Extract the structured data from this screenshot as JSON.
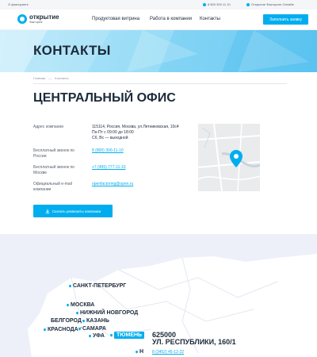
{
  "topbar": {
    "about": "О факторинге",
    "phone": "8 800 300 11 10",
    "online": "Открытие Факторинг Онлайн"
  },
  "header": {
    "logo_name": "открытие",
    "logo_sub": "Факторинг",
    "nav": [
      "Продуктовая витрина",
      "Работа в компании",
      "Контакты"
    ],
    "cta": "Заполнить заявку"
  },
  "hero": {
    "title": "КОНТАКТЫ"
  },
  "breadcrumb": {
    "home": "Главная",
    "separator": "—",
    "current": "Контакты"
  },
  "office": {
    "title": "ЦЕНТРАЛЬНЫЙ ОФИС",
    "rows": [
      {
        "label": "Адрес компании",
        "value_lines": [
          "115114, Россия, Москва, ул.Летниковская, 10с4",
          "Пн-Пт с 09:00 до 18:00",
          "Сб, Вс — выходной"
        ],
        "link": false
      },
      {
        "label": "Бесплатный звонок по России",
        "value_lines": [
          "8 (800) 300-11-10"
        ],
        "link": true
      },
      {
        "label": "Бесплатный звонок по Москве",
        "value_lines": [
          "+7 (495) 777-11-10"
        ],
        "link": true
      },
      {
        "label": "Официальный e-mail компании",
        "value_lines": [
          "openfactoring@open.ru"
        ],
        "link": true
      }
    ],
    "download_label": "Скачать реквизиты компании"
  },
  "regions": {
    "cities": [
      {
        "name": "САНКТ-ПЕТЕРБУРГ",
        "active": false
      },
      {
        "name": "МОСКВА",
        "active": false
      },
      {
        "name": "НИЖНИЙ НОВГОРОД",
        "active": false
      },
      {
        "name": "БЕЛГОРОД",
        "active": false
      },
      {
        "name": "КАЗАНЬ",
        "active": false
      },
      {
        "name": "КРАСНОДАР",
        "active": false
      },
      {
        "name": "САМАРА",
        "active": false
      },
      {
        "name": "УФА",
        "active": false
      },
      {
        "name": "ТЮМЕНЬ",
        "active": true
      },
      {
        "name": "Н",
        "active": false
      }
    ],
    "selected": {
      "zip": "625000",
      "address": "УЛ. РЕСПУБЛИКИ, 160/1",
      "phone": "8 (3452) 45-12-22"
    }
  },
  "colors": {
    "accent": "#00aeef",
    "text": "#1c2a3a"
  }
}
